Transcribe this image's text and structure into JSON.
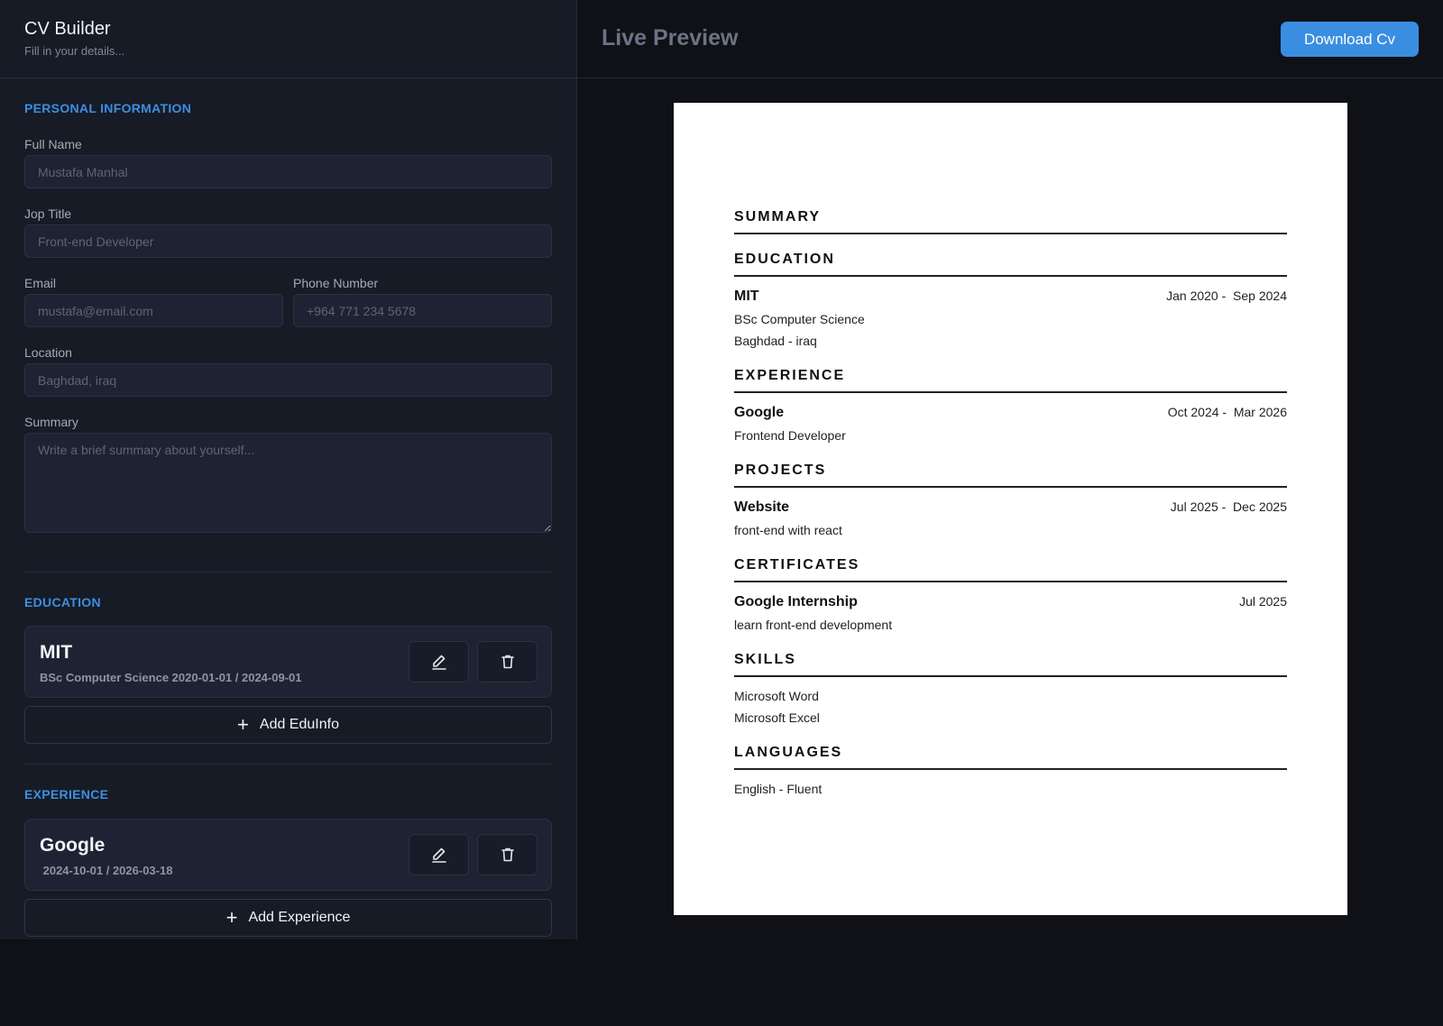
{
  "app": {
    "title": "CV Builder",
    "subtitle": "Fill in your details..."
  },
  "personal": {
    "section_title": "PERSONAL INFORMATION",
    "full_name_label": "Full Name",
    "full_name_placeholder": "Mustafa Manhal",
    "job_title_label": "Jop Title",
    "job_title_placeholder": "Front-end Developer",
    "email_label": "Email",
    "email_placeholder": "mustafa@email.com",
    "phone_label": "Phone Number",
    "phone_placeholder": "+964 771 234 5678",
    "location_label": "Location",
    "location_placeholder": "Baghdad, iraq",
    "summary_label": "Summary",
    "summary_placeholder": "Write a brief summary about yourself..."
  },
  "education": {
    "section_title": "EDUCATION",
    "entry": {
      "title": "MIT",
      "subtitle": "BSc Computer Science  2020-01-01 / 2024-09-01"
    },
    "add_label": "Add EduInfo"
  },
  "experience": {
    "section_title": "EXPERIENCE",
    "entry": {
      "title": "Google",
      "subtitle": " 2024-10-01 / 2026-03-18"
    },
    "add_label": "Add Experience"
  },
  "preview": {
    "title": "Live Preview",
    "download_label": "Download Cv",
    "cv": {
      "summary_heading": "SUMMARY",
      "education_heading": "EDUCATION",
      "education": {
        "title": "MIT",
        "date": "Jan 2020 -  Sep 2024",
        "degree": "BSc Computer Science",
        "location": "Baghdad - iraq"
      },
      "experience_heading": "EXPERIENCE",
      "experience": {
        "title": "Google",
        "date": "Oct 2024 -  Mar 2026",
        "role": "Frontend Developer"
      },
      "projects_heading": "PROJECTS",
      "project": {
        "title": "Website",
        "date": "Jul 2025 -  Dec 2025",
        "desc": "front-end with react"
      },
      "certificates_heading": "CERTIFICATES",
      "certificate": {
        "title": "Google Internship",
        "date": "Jul 2025",
        "desc": "learn front-end development"
      },
      "skills_heading": "SKILLS",
      "skills": [
        "Microsoft Word",
        "Microsoft Excel"
      ],
      "languages_heading": "LANGUAGES",
      "languages": [
        "English - Fluent"
      ]
    }
  },
  "colors": {
    "accent": "#3d8fe0",
    "button": "#3a8ee2",
    "panel": "#161b26",
    "background": "#0f1117"
  }
}
